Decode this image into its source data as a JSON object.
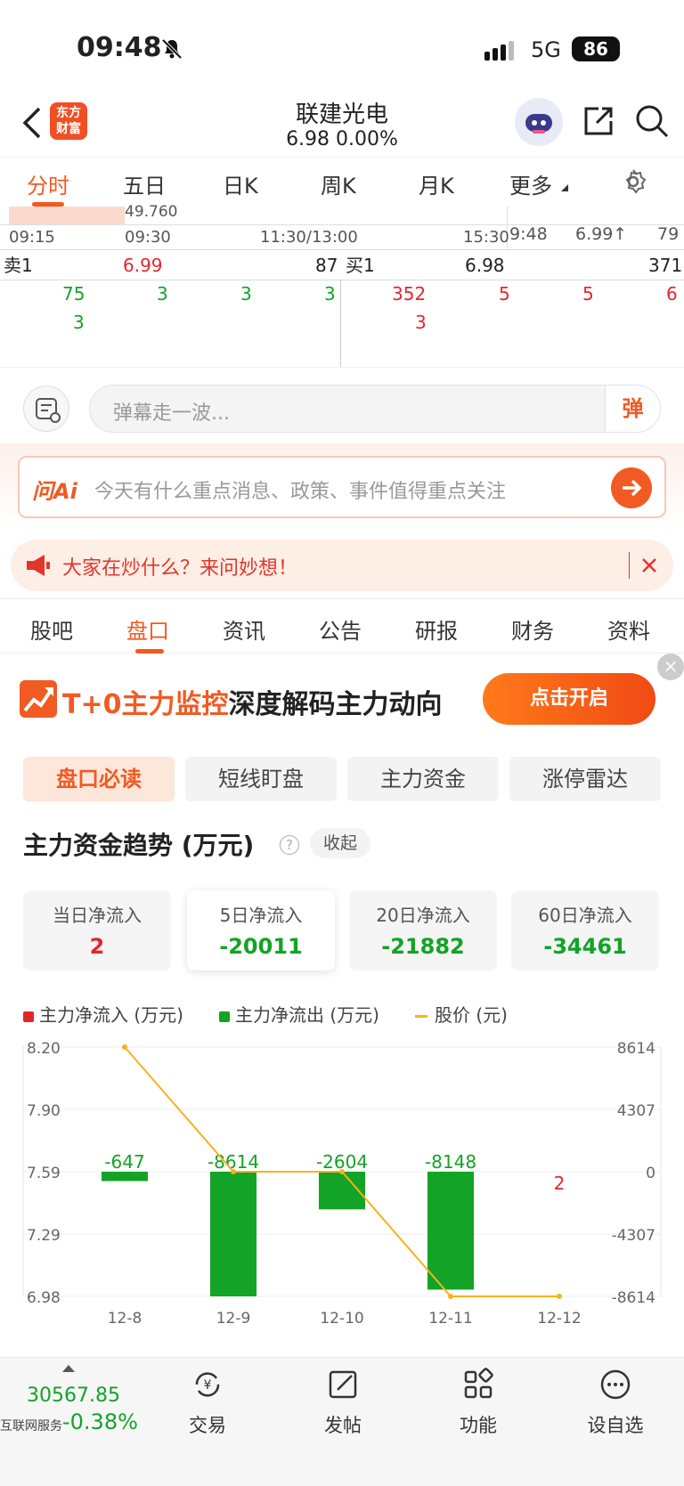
{
  "status": {
    "time": "09:48",
    "network": "5G",
    "battery": "86"
  },
  "header": {
    "logo": "东方\n财富",
    "stock_name": "联建光电",
    "price_line": "6.98  0.00%"
  },
  "chart_tabs": [
    "分时",
    "五日",
    "日K",
    "周K",
    "月K",
    "更多"
  ],
  "intraday": {
    "top_value": "49.760",
    "times": [
      "09:15",
      "09:30",
      "11:30/13:00",
      "15:30"
    ],
    "tick": {
      "time": "9:48",
      "price": "6.99↑",
      "volume": "79"
    },
    "sell1": {
      "label": "卖1",
      "price": "6.99",
      "volume": "87"
    },
    "buy1": {
      "label": "买1",
      "price": "6.98",
      "volume": "371"
    },
    "sell_queue_row1": [
      "75",
      "3",
      "3",
      "3"
    ],
    "sell_queue_row2": [
      "3"
    ],
    "buy_queue_row1": [
      "352",
      "5",
      "5",
      "6"
    ],
    "buy_queue_row2": [
      "3"
    ]
  },
  "danmu": {
    "placeholder": "弹幕走一波...",
    "send_label": "弹"
  },
  "ai": {
    "logo": "问Ai",
    "prompt": "今天有什么重点消息、政策、事件值得重点关注"
  },
  "notice": {
    "text": "大家在炒什么？来问妙想！"
  },
  "section_tabs": [
    "股吧",
    "盘口",
    "资讯",
    "公告",
    "研报",
    "财务",
    "资料"
  ],
  "promo": {
    "text_highlight": "T+0主力监控",
    "text_rest": "深度解码主力动向",
    "button": "点击开启"
  },
  "sub_tabs": [
    "盘口必读",
    "短线盯盘",
    "主力资金",
    "涨停雷达"
  ],
  "trend": {
    "title": "主力资金趋势 (万元)",
    "collapse": "收起",
    "cards": [
      {
        "label": "当日净流入",
        "value": "2",
        "color": "#e4262c"
      },
      {
        "label": "5日净流入",
        "value": "-20011",
        "color": "#13a326"
      },
      {
        "label": "20日净流入",
        "value": "-21882",
        "color": "#13a326"
      },
      {
        "label": "60日净流入",
        "value": "-34461",
        "color": "#13a326"
      }
    ],
    "legend": [
      "主力净流入 (万元)",
      "主力净流出 (万元)",
      "股价 (元)"
    ]
  },
  "chart_data": {
    "type": "bar",
    "categories": [
      "12-8",
      "12-9",
      "12-10",
      "12-11",
      "12-12"
    ],
    "series": [
      {
        "name": "主力净流入 (万元)",
        "values": [
          -647,
          -8614,
          -2604,
          -8148,
          2
        ],
        "color_pos": "#e4262c",
        "color_neg": "#13a326"
      },
      {
        "name": "股价 (元)",
        "type": "line",
        "values": [
          8.2,
          7.59,
          7.59,
          6.98,
          6.98
        ],
        "color": "#f7b21a"
      }
    ],
    "left_axis_ticks": [
      "8.20",
      "7.90",
      "7.59",
      "7.29",
      "6.98"
    ],
    "right_axis_ticks": [
      "8614",
      "4307",
      "0",
      "-4307",
      "-8614"
    ],
    "ylim_left": [
      6.98,
      8.2
    ],
    "ylim_right": [
      -8614,
      8614
    ],
    "grid": true
  },
  "bottom": {
    "index_value": "30567.85",
    "index_name": "互联网服务",
    "index_change": "-0.38%",
    "nav": [
      "交易",
      "发帖",
      "功能",
      "设自选"
    ]
  }
}
